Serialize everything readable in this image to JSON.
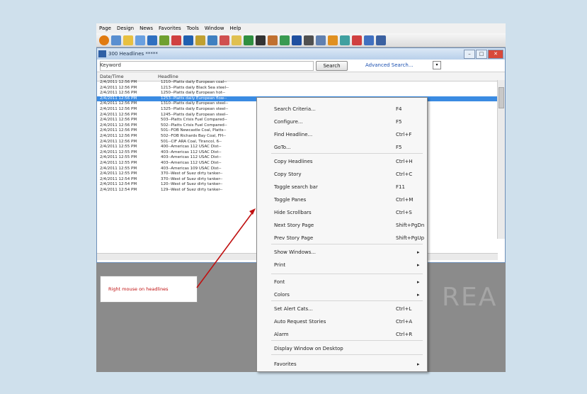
{
  "app_menu": [
    "Page",
    "Design",
    "News",
    "Favorites",
    "Tools",
    "Window",
    "Help"
  ],
  "window": {
    "title": "300 Headlines *****",
    "controls": [
      "–",
      "□",
      "✕"
    ]
  },
  "search": {
    "keyword_label": "Keyword",
    "button": "Search",
    "advanced": "Advanced Search...",
    "box": "▾"
  },
  "columns": {
    "datetime": "Date/Time",
    "headline": "Headline"
  },
  "rows": [
    {
      "d": "2/4/2011 12:56 PM",
      "h": "1210--Platts daily European coal--"
    },
    {
      "d": "2/4/2011 12:56 PM",
      "h": "1213--Platts daily Black Sea steel--"
    },
    {
      "d": "2/4/2011 12:56 PM",
      "h": "1250--Platts daily European hot--"
    },
    {
      "d": "2/4/2011 12:56 PM",
      "h": "1253--Platts daily European flow--",
      "sel": true
    },
    {
      "d": "2/4/2011 12:56 PM",
      "h": "1310--Platts daily European steel--"
    },
    {
      "d": "2/4/2011 12:56 PM",
      "h": "1325--Platts daily European steel--"
    },
    {
      "d": "2/4/2011 12:56 PM",
      "h": "1245--Platts daily European steel--"
    },
    {
      "d": "2/4/2011 12:56 PM",
      "h": "503--Platts Crisis Fuel Compared--"
    },
    {
      "d": "2/4/2011 12:56 PM",
      "h": "502--Platts Crisis Fuel Compared--"
    },
    {
      "d": "2/4/2011 12:56 PM",
      "h": "501--FOB Newcastle Coal, Platts--"
    },
    {
      "d": "2/4/2011 12:56 PM",
      "h": "502--FOB Richards Bay Coal, FH--"
    },
    {
      "d": "2/4/2011 12:56 PM",
      "h": "501--CIF ARA Coal, Tirancol, 6--"
    },
    {
      "d": "2/4/2011 12:55 PM",
      "h": "400--Americas 112 USAC Dist--"
    },
    {
      "d": "2/4/2011 12:55 PM",
      "h": "403--Americas 112 USAC Dist--"
    },
    {
      "d": "2/4/2011 12:55 PM",
      "h": "403--Americas 112 USAC Dist--"
    },
    {
      "d": "2/4/2011 12:55 PM",
      "h": "403--Americas 112 USAC Dist--"
    },
    {
      "d": "2/4/2011 12:55 PM",
      "h": "403--Americas 109 USAC Dist--"
    },
    {
      "d": "2/4/2011 12:55 PM",
      "h": "370--West of Suez dirty tanker--"
    },
    {
      "d": "2/4/2011 12:54 PM",
      "h": "370--West of Suez dirty tanker--"
    },
    {
      "d": "2/4/2011 12:54 PM",
      "h": "120--West of Suez dirty tanker--"
    },
    {
      "d": "2/4/2011 12:54 PM",
      "h": "129--West of Suez dirty tanker--"
    }
  ],
  "callout": "Right mouse on headlines",
  "watermark": "REA",
  "context_menu": [
    {
      "label": "Search Criteria...",
      "shortcut": "F4"
    },
    {
      "label": "Configure...",
      "shortcut": "F5"
    },
    {
      "label": "Find Headline...",
      "shortcut": "Ctrl+F"
    },
    {
      "label": "GoTo...",
      "shortcut": "F5"
    },
    {
      "label": "Copy Headlines",
      "shortcut": "Ctrl+H"
    },
    {
      "label": "Copy Story",
      "shortcut": "Ctrl+C"
    },
    {
      "label": "Toggle search bar",
      "shortcut": "F11"
    },
    {
      "label": "Toggle Panes",
      "shortcut": "Ctrl+M"
    },
    {
      "label": "Hide Scrollbars",
      "shortcut": "Ctrl+S"
    },
    {
      "label": "Next Story Page",
      "shortcut": "Shift+PgDn"
    },
    {
      "label": "Prev Story Page",
      "shortcut": "Shift+PgUp"
    },
    {
      "label": "Show Windows...",
      "shortcut": "",
      "submenu": true
    },
    {
      "label": "Print",
      "shortcut": "",
      "submenu": true
    },
    {
      "label": "Font",
      "shortcut": "",
      "submenu": true
    },
    {
      "label": "Colors",
      "shortcut": "",
      "submenu": true
    },
    {
      "label": "Set Alert Cats...",
      "shortcut": "Ctrl+L"
    },
    {
      "label": "Auto Request Stories",
      "shortcut": "Ctrl+A"
    },
    {
      "label": "Alarm",
      "shortcut": "Ctrl+R"
    },
    {
      "label": "Display Window on Desktop",
      "shortcut": ""
    },
    {
      "label": "Favorites",
      "shortcut": "",
      "submenu": true
    }
  ],
  "colors": {
    "selection": "#3a8be2",
    "callout_text": "#c01010",
    "arrow": "#c01010"
  }
}
